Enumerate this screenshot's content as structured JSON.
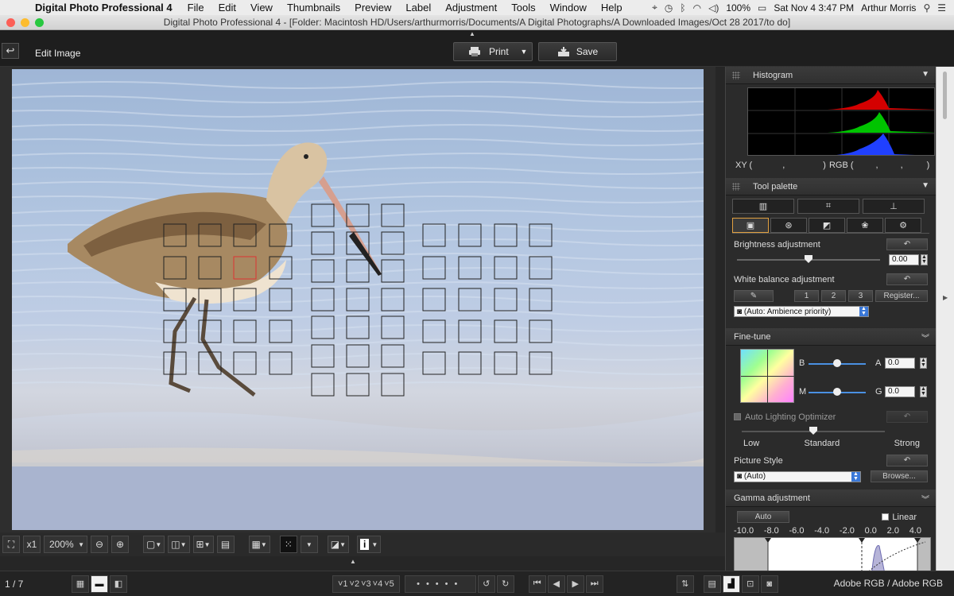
{
  "menubar": {
    "apple": "",
    "app_name": "Digital Photo Professional 4",
    "items": [
      "File",
      "Edit",
      "View",
      "Thumbnails",
      "Preview",
      "Label",
      "Adjustment",
      "Tools",
      "Window",
      "Help"
    ],
    "battery": "100%",
    "clock": "Sat Nov 4  3:47 PM",
    "user": "Arthur Morris"
  },
  "window": {
    "title": "Digital Photo Professional 4 - [Folder: Macintosh HD/Users/arthurmorris/Documents/A Digital Photographs/A Downloaded Images/Oct 28 2017/to do]"
  },
  "toolbar": {
    "back_icon": "↩",
    "mode_label": "Edit Image",
    "print_label": "Print",
    "save_label": "Save"
  },
  "viewbar": {
    "fit_icon": "⛶",
    "x1_label": "x1",
    "zoom_value": "200%",
    "zoom_out_icon": "⊖",
    "zoom_in_icon": "⊕",
    "info_icon": "i"
  },
  "statusbar": {
    "frame_count": "1 / 7",
    "rating": [
      "˅1",
      "˅2",
      "˅3",
      "˅4",
      "˅5"
    ],
    "color_space": "Adobe RGB / Adobe RGB"
  },
  "histogram": {
    "title": "Histogram",
    "xy_label": "XY (",
    "xy_sep": ",",
    "xy_close": ")",
    "rgb_label": "RGB (",
    "rgb_sep1": ",",
    "rgb_sep2": ",",
    "rgb_close": ")",
    "colors": {
      "red": "#d40000",
      "green": "#00c400",
      "blue": "#2040ff"
    }
  },
  "tool_palette": {
    "title": "Tool palette",
    "brightness": {
      "label": "Brightness adjustment",
      "value": "0.00",
      "level": 0.5
    },
    "white_balance": {
      "label": "White balance adjustment",
      "presets": [
        "1",
        "2",
        "3"
      ],
      "register_label": "Register...",
      "mode_value": "(Auto: Ambience priority)"
    }
  },
  "fine_tune": {
    "title": "Fine-tune",
    "b_label": "B",
    "a_label": "A",
    "a_value": "0.0",
    "m_label": "M",
    "g_label": "G",
    "g_value": "0.0",
    "b_level": 0.5,
    "m_level": 0.5,
    "alo_label": "Auto Lighting Optimizer",
    "alo_low": "Low",
    "alo_standard": "Standard",
    "alo_strong": "Strong",
    "alo_level": 0.5,
    "picture_style_label": "Picture Style",
    "picture_style_value": "(Auto)",
    "browse_label": "Browse..."
  },
  "gamma": {
    "title": "Gamma adjustment",
    "auto_label": "Auto",
    "linear_label": "Linear",
    "scale": [
      "-10.0",
      "-8.0",
      "-6.0",
      "-4.0",
      "-2.0",
      "0.0",
      "2.0",
      "4.0"
    ]
  }
}
